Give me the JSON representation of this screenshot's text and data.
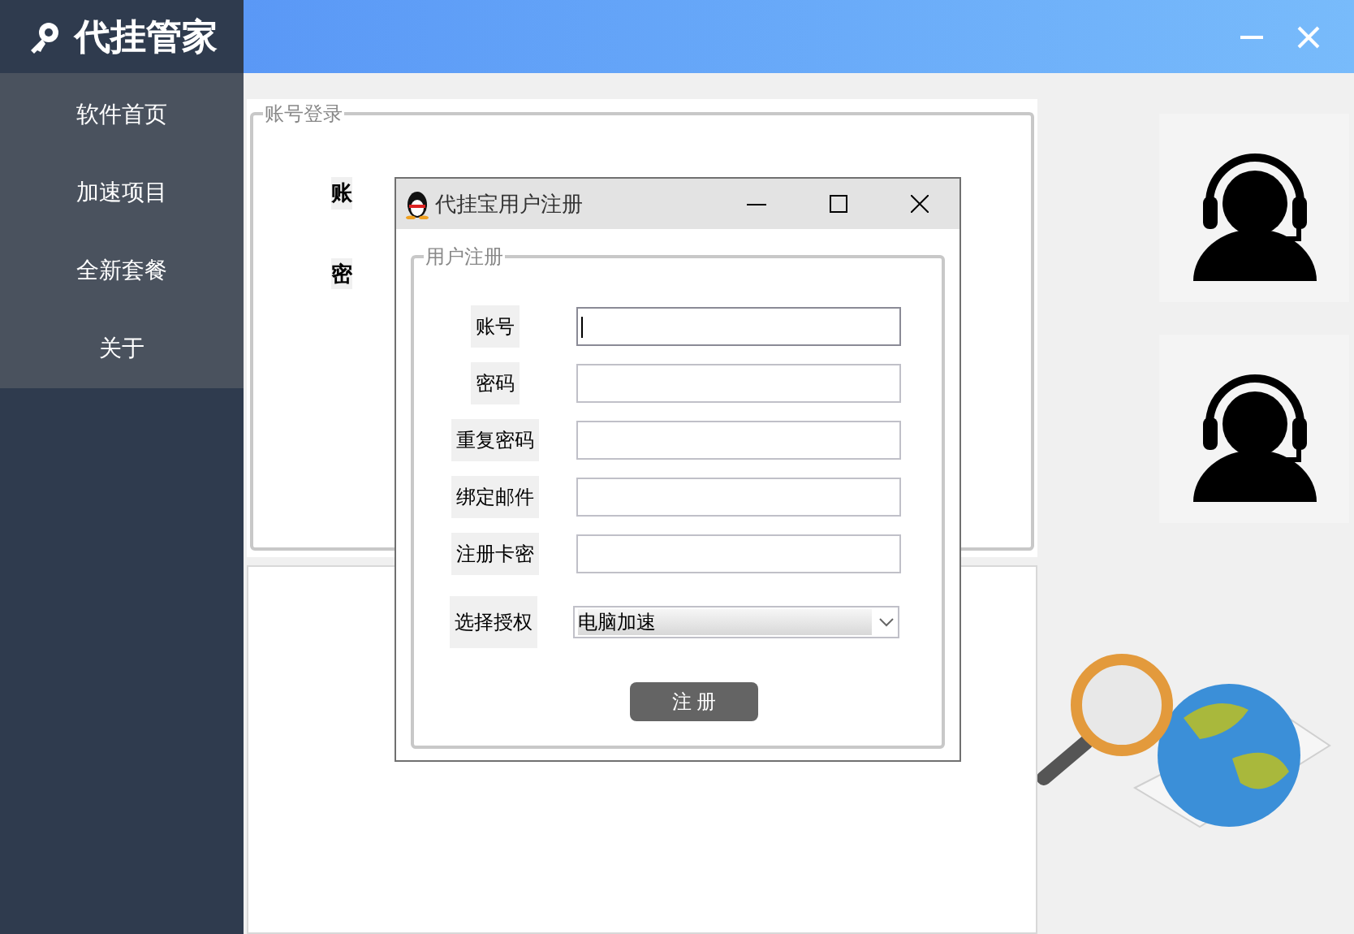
{
  "app": {
    "title": "代挂管家"
  },
  "menu": [
    {
      "label": "软件首页"
    },
    {
      "label": "加速项目"
    },
    {
      "label": "全新套餐"
    },
    {
      "label": "关于"
    }
  ],
  "login_group": {
    "title": "账号登录",
    "labels": [
      "账",
      "密"
    ]
  },
  "dialog": {
    "title": "代挂宝用户注册",
    "group_title": "用户注册",
    "fields": [
      {
        "label": "账号",
        "focused": true
      },
      {
        "label": "密码",
        "focused": false
      },
      {
        "label": "重复密码",
        "focused": false
      },
      {
        "label": "绑定邮件",
        "focused": false
      },
      {
        "label": "注册卡密",
        "focused": false
      }
    ],
    "select": {
      "label": "选择授权",
      "value": "电脑加速"
    },
    "button": "注 册"
  }
}
